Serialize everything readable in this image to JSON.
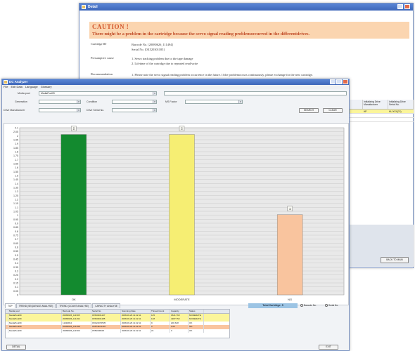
{
  "back_window": {
    "title": "Detail",
    "caution_title": "CAUTION !",
    "caution_message": "There might be a problem in the cartridge because the servo signal reading problemoccurred in the differentdrives.",
    "cartridge_id_label": "Cartridge ID",
    "barcode_line": "Barcode No. [20080626_111494]",
    "serial_line": "Serial No. [0X520301185]",
    "presumptive_label": "Presumptive cause",
    "cause_1": "1. Servo tracking problem due to the tape damage",
    "cause_2": "2. Lifetime of the cartridge due to repeated read/write",
    "recommendation_label": "Recommendation",
    "recommendation_text": "1. Please note the servo signal reading problem occurrence in the future. If the problemoccurs continuously, please exchange for the new cartridge.",
    "right_table_headers": [
      "s.of ID",
      "Initializing Drive Manufacturer",
      "Initializing Drive Serial No."
    ],
    "right_table_row": [
      "",
      "HP",
      "HU.XXX(74)"
    ],
    "back_button": "BACK TO MAIN"
  },
  "front_window": {
    "title": "DC Analyzer",
    "menu": [
      "File",
      "Edit Data",
      "Language",
      "Glossary"
    ],
    "media_label": "Media pool",
    "media_value": "MediaPool09",
    "generation_label": "Generation",
    "condition_label": "Condition",
    "ms_factor_label": "MS Factor",
    "drive_manufacturer_label": "Drive Manufacturer",
    "drive_serial_label": "Drive Serial No.",
    "search_button": "SEARCH",
    "clear_button": "CLEAR",
    "tabs": [
      "TOP",
      "TREND (SEQUENCE ANALYSE)",
      "TREND (COUNT ANALYSE)",
      "CAPACITY ANALYSE"
    ],
    "total_label": "Total Cartridge: 5",
    "radio_barcode": "Barcode No.",
    "radio_serial": "Serial No.",
    "table_headers": [
      "",
      "Media pool",
      "Barcode No.",
      "Serial No.",
      "Scanning Date",
      "Thread Count",
      "Capacity",
      "Status"
    ],
    "table_rows": [
      [
        "",
        "MediaPool09",
        "20080626_111505",
        "0X520301137",
        "2008-06-26 11:22:11",
        "125",
        "1521.763",
        "MODERATE"
      ],
      [
        "",
        "MediaPool09",
        "20080626_111494",
        "0X520301185",
        "2008-06-26 11:22:11",
        "148",
        "4287.752",
        "MODERATE"
      ],
      [
        "",
        "MediaPool09",
        "11494812",
        "0XD24070535",
        "2008-06-26 11:22:11",
        "9",
        "200.618",
        "OK"
      ],
      [
        "",
        "MediaPool09",
        "20080626_111498",
        "0X8T4EV1287",
        "2008-06-26 11:22:11",
        "0",
        "0.00",
        "NG"
      ],
      [
        "",
        "MediaPool09",
        "20080626_111500",
        "0T8S006615",
        "2008-06-26 11:22:11",
        "24",
        "0",
        "OK"
      ]
    ],
    "detail_button": "DETAIL",
    "exit_button": "EXIT"
  },
  "chart_data": {
    "type": "bar",
    "categories": [
      "OK",
      "MODERATE",
      "NG"
    ],
    "values": [
      2,
      2,
      1
    ],
    "value_labels": [
      "2",
      "2",
      "1"
    ],
    "bar_colors": [
      "#138a2f",
      "#f6ee73",
      "#f9c49e"
    ],
    "bar_heights_fraction": [
      0.96,
      0.96,
      0.48
    ],
    "yticks": [
      "2.1",
      "2.05",
      "2",
      "1.95",
      "1.9",
      "1.85",
      "1.8",
      "1.75",
      "1.7",
      "1.65",
      "1.6",
      "1.55",
      "1.5",
      "1.45",
      "1.4",
      "1.35",
      "1.3",
      "1.25",
      "1.2",
      "1.15",
      "1.1",
      "1.05",
      "1",
      "0.95",
      "0.9",
      "0.85",
      "0.8",
      "0.75",
      "0.7",
      "0.65",
      "0.6",
      "0.55",
      "0.5",
      "0.45",
      "0.4",
      "0.35",
      "0.3",
      "0.25",
      "0.2",
      "0.15",
      "0.1",
      "0.05",
      "0"
    ],
    "ylim": [
      0,
      2.1
    ],
    "grid": true
  }
}
